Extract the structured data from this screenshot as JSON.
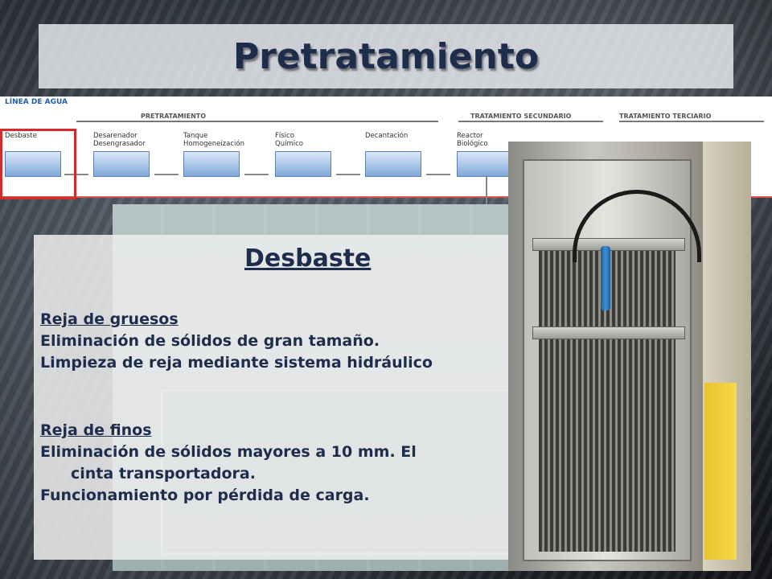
{
  "title": "Pretratamiento",
  "flow": {
    "header": "LÍNEA DE AGUA",
    "sections": [
      "PRETRATAMIENTO",
      "TRATAMIENTO SECUNDARIO",
      "TRATAMIENTO TERCIARIO"
    ],
    "units": [
      "Desbaste",
      "Desarenador\nDesengrasador",
      "Tanque\nHomogeneización",
      "Físico\nQuímico",
      "Decantación",
      "Reactor\nBiológico"
    ]
  },
  "panel": {
    "heading": "Desbaste",
    "gruesos": {
      "title": "Reja de gruesos",
      "lines": [
        "Eliminación de sólidos de gran tamaño.",
        "Limpieza de reja mediante sistema hidráulico"
      ]
    },
    "finos": {
      "title": "Reja de finos",
      "line1": "Eliminación de sólidos mayores a 10 mm. El",
      "line2": "cinta transportadora.",
      "line3": "Funcionamiento por pérdida de carga."
    }
  },
  "colors": {
    "title_text": "#1f2d4c",
    "highlight": "#d62b2b",
    "flow_header": "#1f5fa8"
  }
}
